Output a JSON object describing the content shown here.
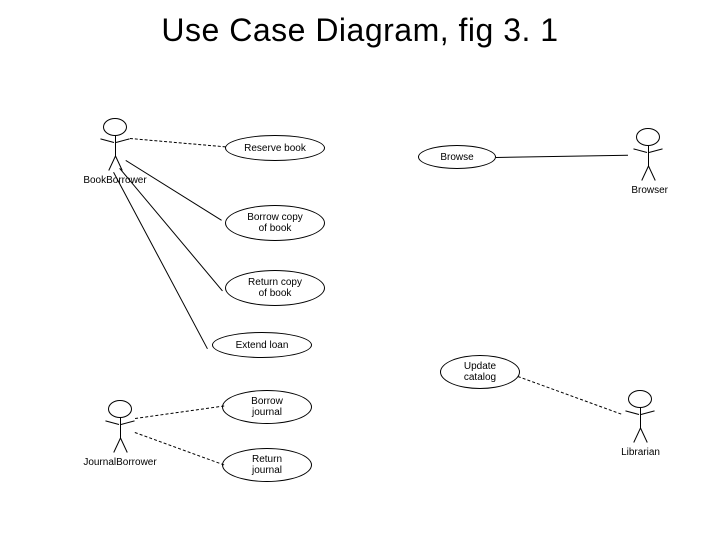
{
  "title": "Use Case Diagram, fig 3. 1",
  "actors": {
    "book_borrower": {
      "name": "BookBorrower"
    },
    "browser": {
      "name": "Browser"
    },
    "journal_borrower": {
      "name": "JournalBorrower"
    },
    "librarian": {
      "name": "Librarian"
    }
  },
  "usecases": {
    "reserve_book": "Reserve book",
    "browse": "Browse",
    "borrow_copy": "Borrow copy\nof book",
    "return_copy": "Return copy\nof book",
    "extend_loan": "Extend loan",
    "borrow_journal": "Borrow\njournal",
    "return_journal": "Return\njournal",
    "update_catalog": "Update\ncatalog"
  },
  "associations": [
    {
      "from": "book_borrower",
      "to": "reserve_book"
    },
    {
      "from": "book_borrower",
      "to": "borrow_copy"
    },
    {
      "from": "book_borrower",
      "to": "return_copy"
    },
    {
      "from": "book_borrower",
      "to": "extend_loan"
    },
    {
      "from": "browser",
      "to": "browse"
    },
    {
      "from": "journal_borrower",
      "to": "borrow_journal"
    },
    {
      "from": "journal_borrower",
      "to": "return_journal"
    },
    {
      "from": "librarian",
      "to": "update_catalog"
    }
  ]
}
